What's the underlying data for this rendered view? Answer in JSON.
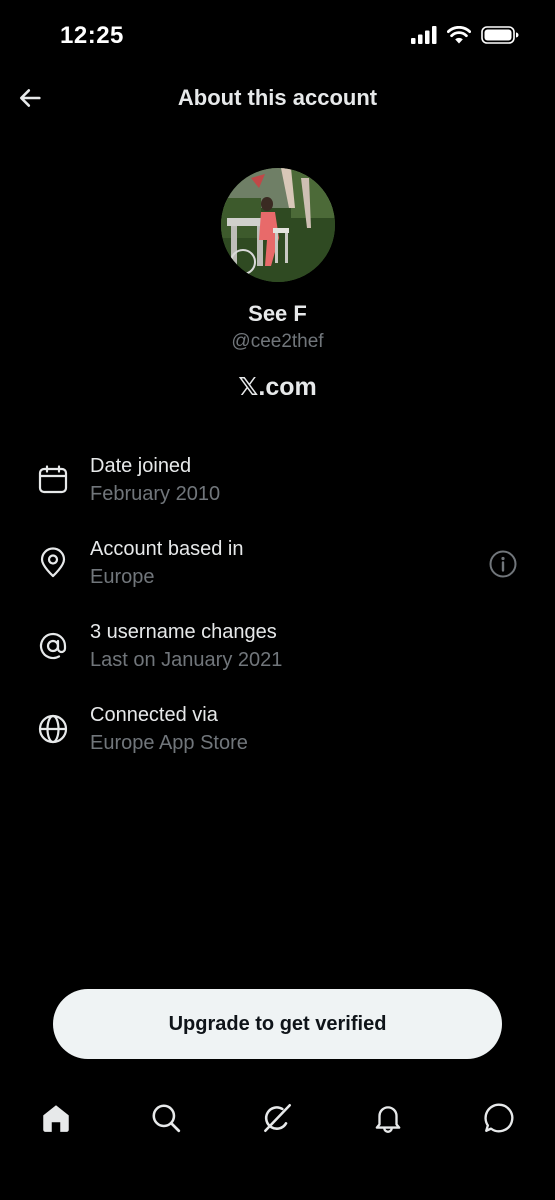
{
  "status_bar": {
    "time": "12:25",
    "icons": [
      "cellular-signal-icon",
      "wifi-icon",
      "battery-icon"
    ]
  },
  "header": {
    "title": "About this account",
    "back_icon": "arrow-left-icon"
  },
  "profile": {
    "display_name": "See F",
    "handle": "@cee2thef",
    "brand": "𝕏.com"
  },
  "info_rows": [
    {
      "icon": "calendar-icon",
      "title": "Date joined",
      "subtitle": "February 2010"
    },
    {
      "icon": "location-pin-icon",
      "title": "Account based in",
      "subtitle": "Europe",
      "extra_icon": "info-icon"
    },
    {
      "icon": "at-sign-icon",
      "title": "3 username changes",
      "subtitle": "Last on January 2021"
    },
    {
      "icon": "globe-icon",
      "title": "Connected via",
      "subtitle": "Europe App Store"
    }
  ],
  "upgrade_button": {
    "label": "Upgrade to get verified"
  },
  "tab_bar": {
    "tabs": [
      "home-icon",
      "search-icon",
      "grok-icon",
      "notifications-bell-icon",
      "messages-icon"
    ]
  },
  "colors": {
    "background": "#000000",
    "primary_text": "#e7e9ea",
    "secondary_text": "#71767b",
    "button_bg": "#eff3f4",
    "button_text": "#0f1419"
  }
}
